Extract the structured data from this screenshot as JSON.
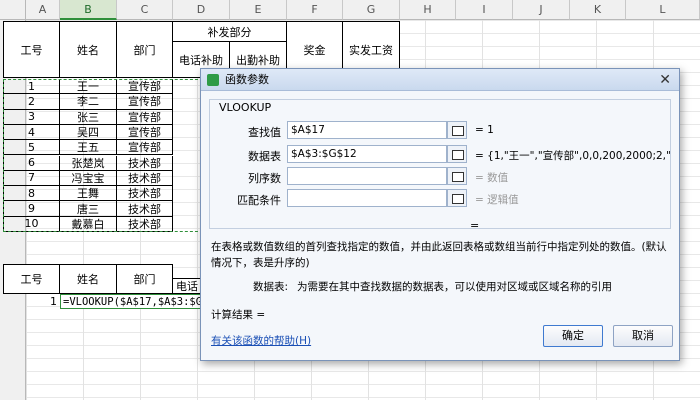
{
  "columns": [
    "A",
    "B",
    "C",
    "D",
    "E",
    "F",
    "G",
    "H",
    "I",
    "J",
    "K",
    "L"
  ],
  "header": {
    "col_a": "工号",
    "col_b": "姓名",
    "col_c": "部门",
    "group": "补发部分",
    "col_d": "电话补助",
    "col_e": "出勤补助",
    "col_f": "奖金",
    "col_g": "实发工资"
  },
  "rows": [
    {
      "no": "1",
      "name": "王一",
      "dept": "宣传部"
    },
    {
      "no": "2",
      "name": "李二",
      "dept": "宣传部"
    },
    {
      "no": "3",
      "name": "张三",
      "dept": "宣传部"
    },
    {
      "no": "4",
      "name": "吴四",
      "dept": "宣传部"
    },
    {
      "no": "5",
      "name": "王五",
      "dept": "宣传部"
    },
    {
      "no": "6",
      "name": "张楚岚",
      "dept": "技术部"
    },
    {
      "no": "7",
      "name": "冯宝宝",
      "dept": "技术部"
    },
    {
      "no": "8",
      "name": "王舞",
      "dept": "技术部"
    },
    {
      "no": "9",
      "name": "唐三",
      "dept": "技术部"
    },
    {
      "no": "10",
      "name": "戴慕白",
      "dept": "技术部"
    }
  ],
  "lookup": {
    "col_a": "工号",
    "col_b": "姓名",
    "col_c": "部门",
    "col_d": "电话",
    "a_value": "1",
    "formula": "=VLOOKUP($A$17,$A$3:$G"
  },
  "dialog": {
    "title": "函数参数",
    "func_name": "VLOOKUP",
    "fields": [
      {
        "label": "查找值",
        "value": "$A$17",
        "result": "= 1"
      },
      {
        "label": "数据表",
        "value": "$A$3:$G$12",
        "result": "= {1,\"王一\",\"宣传部\",0,0,200,2000;2,\"李二\"..."
      },
      {
        "label": "列序数",
        "value": "",
        "result": "= 数值"
      },
      {
        "label": "匹配条件",
        "value": "",
        "result": "= 逻辑值"
      }
    ],
    "equals": "=",
    "description": "在表格或数值数组的首列查找指定的数值，并由此返回表格或数组当前行中指定列处的数值。(默认情况下，表是升序的)",
    "param_name": "数据表:",
    "param_desc": "为需要在其中查找数据的数据表，可以使用对区域或区域名称的引用",
    "calc_label": "计算结果 =",
    "help_link": "有关该函数的帮助(H)",
    "ok_label": "确定",
    "cancel_label": "取消",
    "close_glyph": "✕"
  }
}
